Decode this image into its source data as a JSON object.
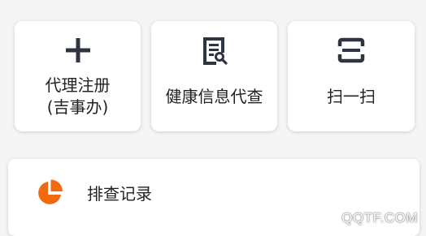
{
  "tiles": [
    {
      "label": "代理注册\n(吉事办)",
      "icon": "plus-icon"
    },
    {
      "label": "健康信息代查",
      "icon": "document-search-icon"
    },
    {
      "label": "扫一扫",
      "icon": "scan-icon"
    }
  ],
  "record": {
    "label": "排查记录",
    "icon": "pie-chart-icon"
  },
  "watermark": "QQTF.COM",
  "colors": {
    "icon_dark": "#2f3540",
    "accent_orange": "#f06a0f",
    "card_bg": "#ffffff",
    "page_bg": "#f5f5f5"
  }
}
